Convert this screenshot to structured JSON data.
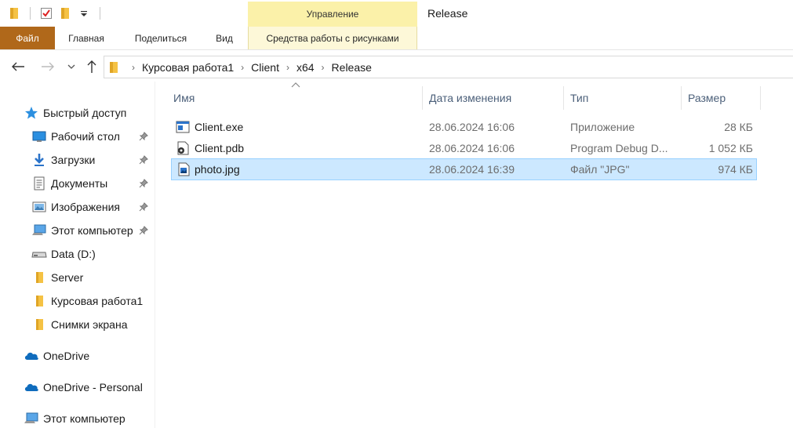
{
  "window": {
    "title": "Release",
    "context_group": "Управление"
  },
  "ribbon": {
    "tabs": [
      {
        "label": "Файл"
      },
      {
        "label": "Главная"
      },
      {
        "label": "Поделиться"
      },
      {
        "label": "Вид"
      },
      {
        "label": "Средства работы с рисунками"
      }
    ]
  },
  "address": {
    "crumbs": [
      "Курсовая работа1",
      "Client",
      "x64",
      "Release"
    ]
  },
  "sidebar": {
    "items": [
      {
        "label": "Быстрый доступ",
        "icon": "star-icon",
        "pinned": false
      },
      {
        "label": "Рабочий стол",
        "icon": "desktop-icon",
        "pinned": true
      },
      {
        "label": "Загрузки",
        "icon": "download-icon",
        "pinned": true
      },
      {
        "label": "Документы",
        "icon": "documents-icon",
        "pinned": true
      },
      {
        "label": "Изображения",
        "icon": "pictures-icon",
        "pinned": true
      },
      {
        "label": "Этот компьютер",
        "icon": "computer-icon",
        "pinned": true
      },
      {
        "label": "Data (D:)",
        "icon": "drive-icon",
        "pinned": false
      },
      {
        "label": "Server",
        "icon": "folder-icon",
        "pinned": false
      },
      {
        "label": "Курсовая работа1",
        "icon": "folder-icon",
        "pinned": false
      },
      {
        "label": "Снимки экрана",
        "icon": "folder-icon",
        "pinned": false
      },
      {
        "label": "OneDrive",
        "icon": "cloud-icon",
        "pinned": false
      },
      {
        "label": "OneDrive - Personal",
        "icon": "cloud-icon",
        "pinned": false
      },
      {
        "label": "Этот компьютер",
        "icon": "computer-icon",
        "pinned": false
      }
    ]
  },
  "columns": {
    "name": "Имя",
    "modified": "Дата изменения",
    "type": "Тип",
    "size": "Размер"
  },
  "files": [
    {
      "name": "Client.exe",
      "modified": "28.06.2024 16:06",
      "type": "Приложение",
      "size": "28 КБ",
      "icon": "exe-icon",
      "selected": false
    },
    {
      "name": "Client.pdb",
      "modified": "28.06.2024 16:06",
      "type": "Program Debug D...",
      "size": "1 052 КБ",
      "icon": "pdb-icon",
      "selected": false
    },
    {
      "name": "photo.jpg",
      "modified": "28.06.2024 16:39",
      "type": "Файл \"JPG\"",
      "size": "974 КБ",
      "icon": "image-icon",
      "selected": true
    }
  ],
  "colors": {
    "accent": "#b0681a",
    "selection": "#cce8ff",
    "header_text": "#4c607a",
    "folder": "#f5c244"
  }
}
